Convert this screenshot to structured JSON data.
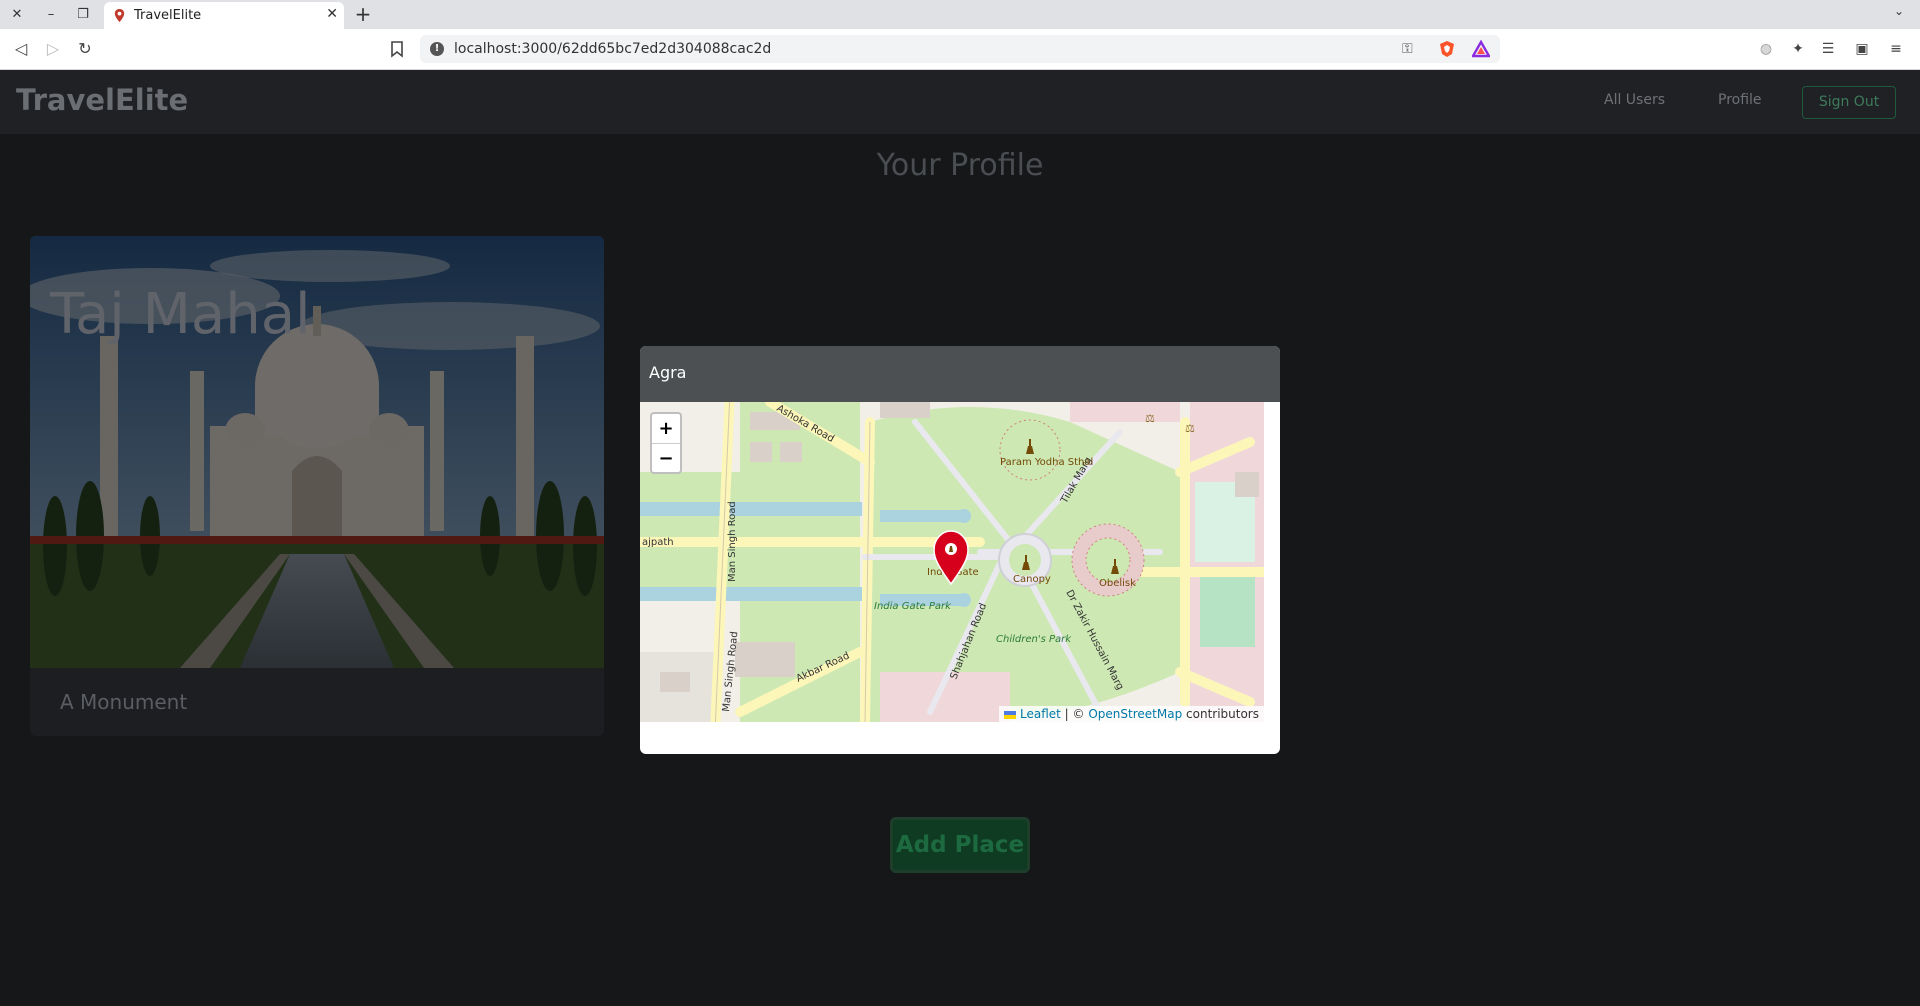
{
  "browser": {
    "tab_title": "TravelElite",
    "url": "localhost:3000/62dd65bc7ed2d304088cac2d",
    "new_tab_glyph": "+",
    "icons": [
      "close-icon",
      "minimize-icon",
      "restore-icon",
      "back-icon",
      "forward-icon",
      "reload-icon",
      "bookmark-icon",
      "key-icon",
      "brave-shield-icon",
      "brave-rewards-icon",
      "extensions-icon",
      "playlist-icon",
      "wallet-icon",
      "menu-icon"
    ]
  },
  "navbar": {
    "brand": "TravelElite",
    "links": [
      "All Users",
      "Profile"
    ],
    "signout": "Sign Out"
  },
  "page": {
    "title": "Your Profile",
    "add_place": "Add Place"
  },
  "card": {
    "title": "Taj Mahal",
    "description": "A Monument"
  },
  "modal": {
    "title": "Agra",
    "zoom_in": "+",
    "zoom_out": "−",
    "attribution_leaflet": "Leaflet",
    "attribution_sep": " | © ",
    "attribution_osm": "OpenStreetMap",
    "attribution_tail": " contributors",
    "map_labels": {
      "ashoka_road": "Ashoka Road",
      "rajpath": "ajpath",
      "man_singh_road": "Man Singh Road",
      "man_singh_road_2": "Man Singh Road",
      "akbar_road": "Akbar Road",
      "india_gate_park": "India Gate Park",
      "india_gate": "India Gate",
      "param_yodha": "Param Yodha Sthal",
      "tilak_marg": "Tilak Marg",
      "canopy": "Canopy",
      "obelisk": "Obelisk",
      "shahjahan_road": "Shahjahan Road",
      "zakir_husain": "Dr Zakir Hussain Marg",
      "childrens_park": "Children's Park"
    }
  },
  "colors": {
    "page_bg": "#161719",
    "navbar_bg": "#202124",
    "modal_header": "#4c5052",
    "marker": "#d6001c",
    "park": "#c8e6a8",
    "road": "#fcf6b9",
    "water": "#aad3df",
    "button_green": "#0f3b22"
  }
}
